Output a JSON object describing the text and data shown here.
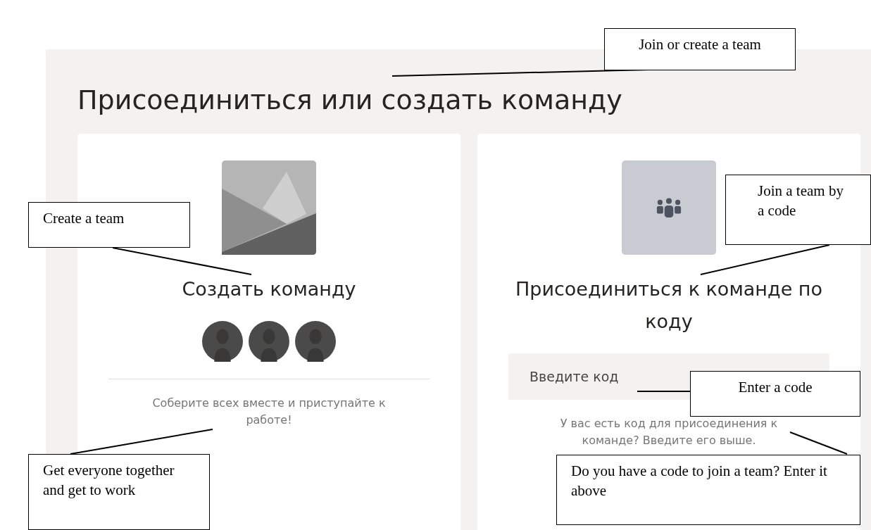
{
  "page": {
    "title": "Присоединиться или создать команду"
  },
  "cards": [
    {
      "kind": "create",
      "title": "Создать команду",
      "description": "Соберите всех вместе и приступайте к работе!"
    },
    {
      "kind": "join",
      "title": "Присоединиться к команде по коду",
      "code_field": {
        "placeholder": "Введите код"
      },
      "description": "У вас есть код для присоединения к команде? Введите его выше."
    }
  ],
  "annotations": [
    {
      "text": "Join or create a team"
    },
    {
      "text": "Create a team"
    },
    {
      "text": "Join a team by a code"
    },
    {
      "text": "Enter a code"
    },
    {
      "text": "Get everyone together and get to work"
    },
    {
      "text": "Do you have a code to join a team? Enter it above"
    }
  ]
}
